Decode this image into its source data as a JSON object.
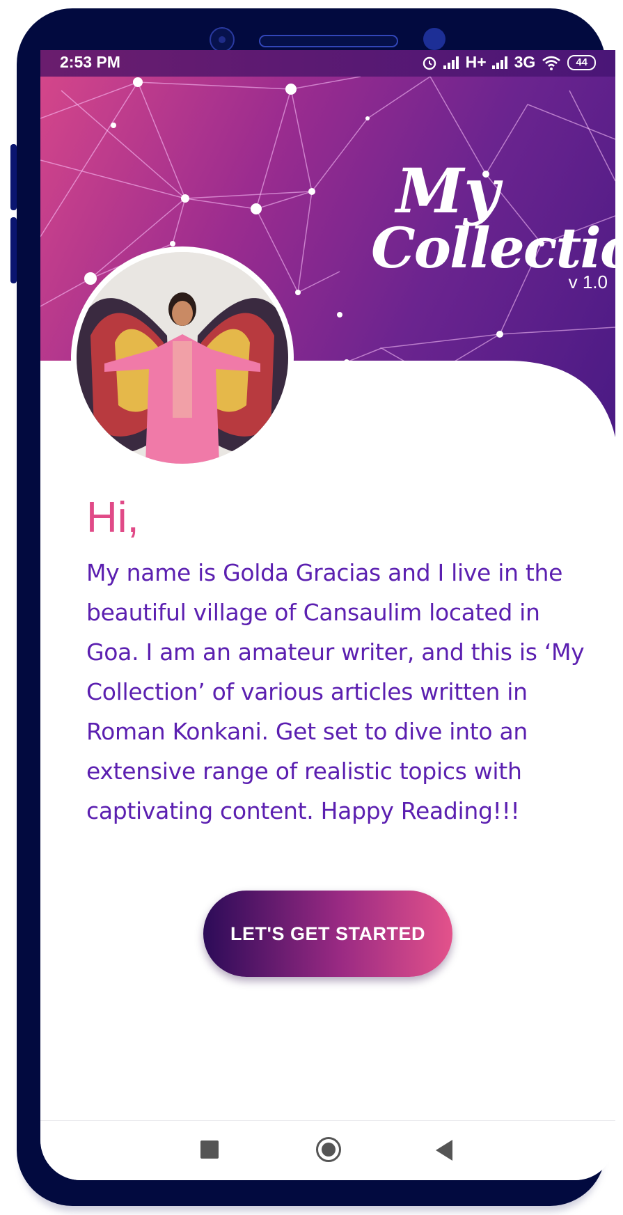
{
  "status_bar": {
    "time": "2:53 PM",
    "network_1": "H+",
    "network_2": "3G",
    "battery": "44",
    "icons": [
      "alarm-icon",
      "signal-icon",
      "signal-icon",
      "wifi-icon",
      "battery-icon"
    ]
  },
  "header": {
    "logo_line1": "My",
    "logo_line2": "Collection",
    "version": "v 1.0"
  },
  "main": {
    "greeting": "Hi,",
    "intro": "My name is Golda Gracias and I live in the beautiful village of Cansaulim located in Goa. I am an amateur writer, and this is ‘My Collection’ of various articles written in Roman Konkani. Get set to dive into an extensive range of realistic topics with captivating content. Happy Reading!!!",
    "cta_label": "LET'S GET STARTED"
  },
  "nav_bar": {
    "icons": [
      "recents-icon",
      "home-icon",
      "back-icon"
    ]
  },
  "colors": {
    "greeting": "#e04a87",
    "body_text": "#5b1fb0",
    "frame": "#020a3f",
    "button_start": "#2c0b58",
    "button_end": "#e3528b"
  }
}
